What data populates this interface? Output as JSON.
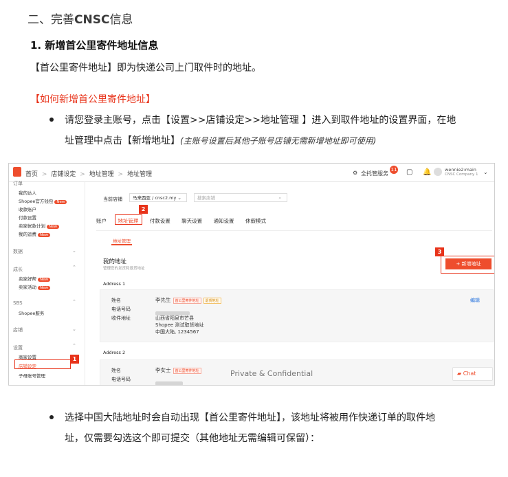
{
  "section_title_prefix": "二、完善",
  "section_title_bold": "CNSC",
  "section_title_suffix": "信息",
  "subsection_title": "1. 新增首公里寄件地址信息",
  "intro_text": "【首公里寄件地址】即为快递公司上门取件时的地址。",
  "howto_heading": "【如何新增首公里寄件地址】",
  "bullet1_line1": "请您登录主账号，点击【设置>>店铺设定>>地址管理 】进入到取件地址的设置界面，在地",
  "bullet1_line2": "址管理中点击【新增地址】",
  "bullet1_note": "(主账号设置后其他子账号店铺无需新增地址即可使用)",
  "bullet2_line1": "选择中国大陆地址时会自动出现【首公里寄件地址】，该地址将被用作快递订单的取件地",
  "bullet2_line2": "址，仅需要勾选这个即可提交（其他地址无需编辑可保留）：",
  "watermark": "Private & Confidential",
  "screenshot": {
    "breadcrumb": [
      "首页",
      ">",
      "店铺设定",
      ">",
      "地址管理",
      ">",
      "地址管理"
    ],
    "service_label": "全托管服务",
    "notif_count": "11",
    "user_name": "wennie2:main",
    "user_company": "CNSC Company 1",
    "sidebar": {
      "sec1": "订单",
      "sec1_items": [
        "我的达人",
        "Shopee官方钱包",
        "收款账户",
        "付款设置",
        "卖家帐款计划",
        "我的运费"
      ],
      "sec2": "数据",
      "sec3": "成长",
      "sec3_items": [
        "卖家好帮",
        "卖家活动"
      ],
      "sec4": "SBS",
      "sec4_items": [
        "Shopee服务"
      ],
      "sec5": "店铺",
      "sec6": "设置",
      "sec6_items": [
        "商家设置",
        "店铺设定",
        "子母账号管理"
      ],
      "hot_tag": "New"
    },
    "current_shop_label": "当前店铺",
    "shop_select": "马来西亚 / cnsc2.my",
    "search_placeholder": "搜索店铺",
    "tabs": [
      "账户",
      "地址管理",
      "付款设置",
      "聊天设置",
      "通知设置",
      "休假模式"
    ],
    "subtab": "地址管理",
    "my_address_title": "我的地址",
    "my_address_desc": "管理您的发货和退货地址",
    "add_address_button": "+ 新增地址",
    "address1_label": "Address 1",
    "address2_label": "Address 2",
    "field_name": "姓名",
    "field_phone": "电话号码",
    "field_address": "收件地址",
    "address1_name": "李先生",
    "address1_tag1": "首公里寄件地址",
    "address1_tag2": "退货地址",
    "address1_line1": "山西省阳泉市芒县",
    "address1_line2": "Shopee 测试取货地址",
    "address1_line3": "中国大陆, 1234567",
    "address2_name": "李女士",
    "address2_tag1": "首公里寄件地址",
    "edit_link": "编辑",
    "chat_label": "Chat",
    "markers": [
      "1",
      "2",
      "3"
    ]
  },
  "colors": {
    "accent": "#ee4d2d",
    "annotation_red": "#e8331a"
  }
}
